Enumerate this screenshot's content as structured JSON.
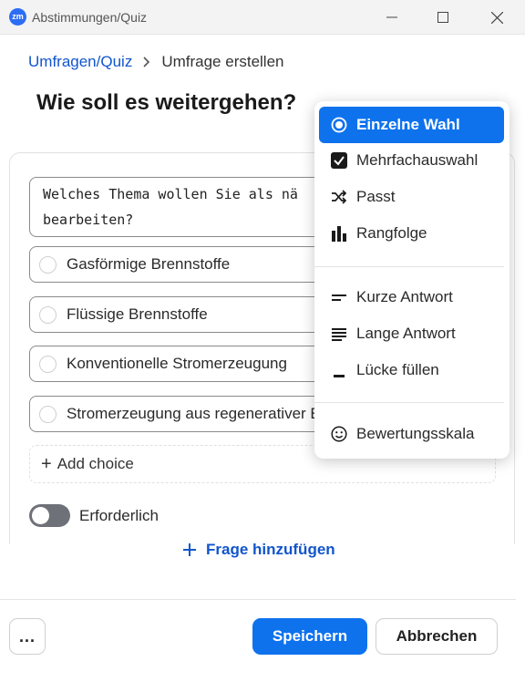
{
  "window": {
    "logo_text": "zm",
    "title": "Abstimmungen/Quiz"
  },
  "breadcrumb": {
    "parent": "Umfragen/Quiz",
    "current": "Umfrage erstellen"
  },
  "page": {
    "title": "Wie soll es weitergehen?"
  },
  "question": {
    "text": "Welches Thema wollen Sie als nä\nbearbeiten?"
  },
  "choices": [
    {
      "label": "Gasförmige Brennstoffe"
    },
    {
      "label": "Flüssige Brennstoffe"
    },
    {
      "label": "Konventionelle Stromerzeugung"
    },
    {
      "label": "Stromerzeugung aus regenerativer E"
    }
  ],
  "add_choice_label": "Add choice",
  "required": {
    "label": "Erforderlich",
    "on": false
  },
  "add_question_label": "Frage hinzufügen",
  "footer": {
    "more_label": "...",
    "save_label": "Speichern",
    "cancel_label": "Abbrechen"
  },
  "question_type_menu": {
    "items": [
      {
        "label": "Einzelne Wahl",
        "icon": "radio-icon",
        "selected": true
      },
      {
        "label": "Mehrfachauswahl",
        "icon": "checkbox-icon",
        "selected": false
      },
      {
        "label": "Passt",
        "icon": "shuffle-icon",
        "selected": false
      },
      {
        "label": "Rangfolge",
        "icon": "bar-chart-icon",
        "selected": false
      },
      {
        "label": "Kurze Antwort",
        "icon": "short-lines-icon",
        "selected": false
      },
      {
        "label": "Lange Antwort",
        "icon": "long-lines-icon",
        "selected": false
      },
      {
        "label": "Lücke füllen",
        "icon": "blank-line-icon",
        "selected": false
      },
      {
        "label": "Bewertungsskala",
        "icon": "smiley-icon",
        "selected": false
      }
    ]
  },
  "colors": {
    "accent": "#0e72ed",
    "link": "#1155cc",
    "toggle_off": "#6e7178"
  }
}
